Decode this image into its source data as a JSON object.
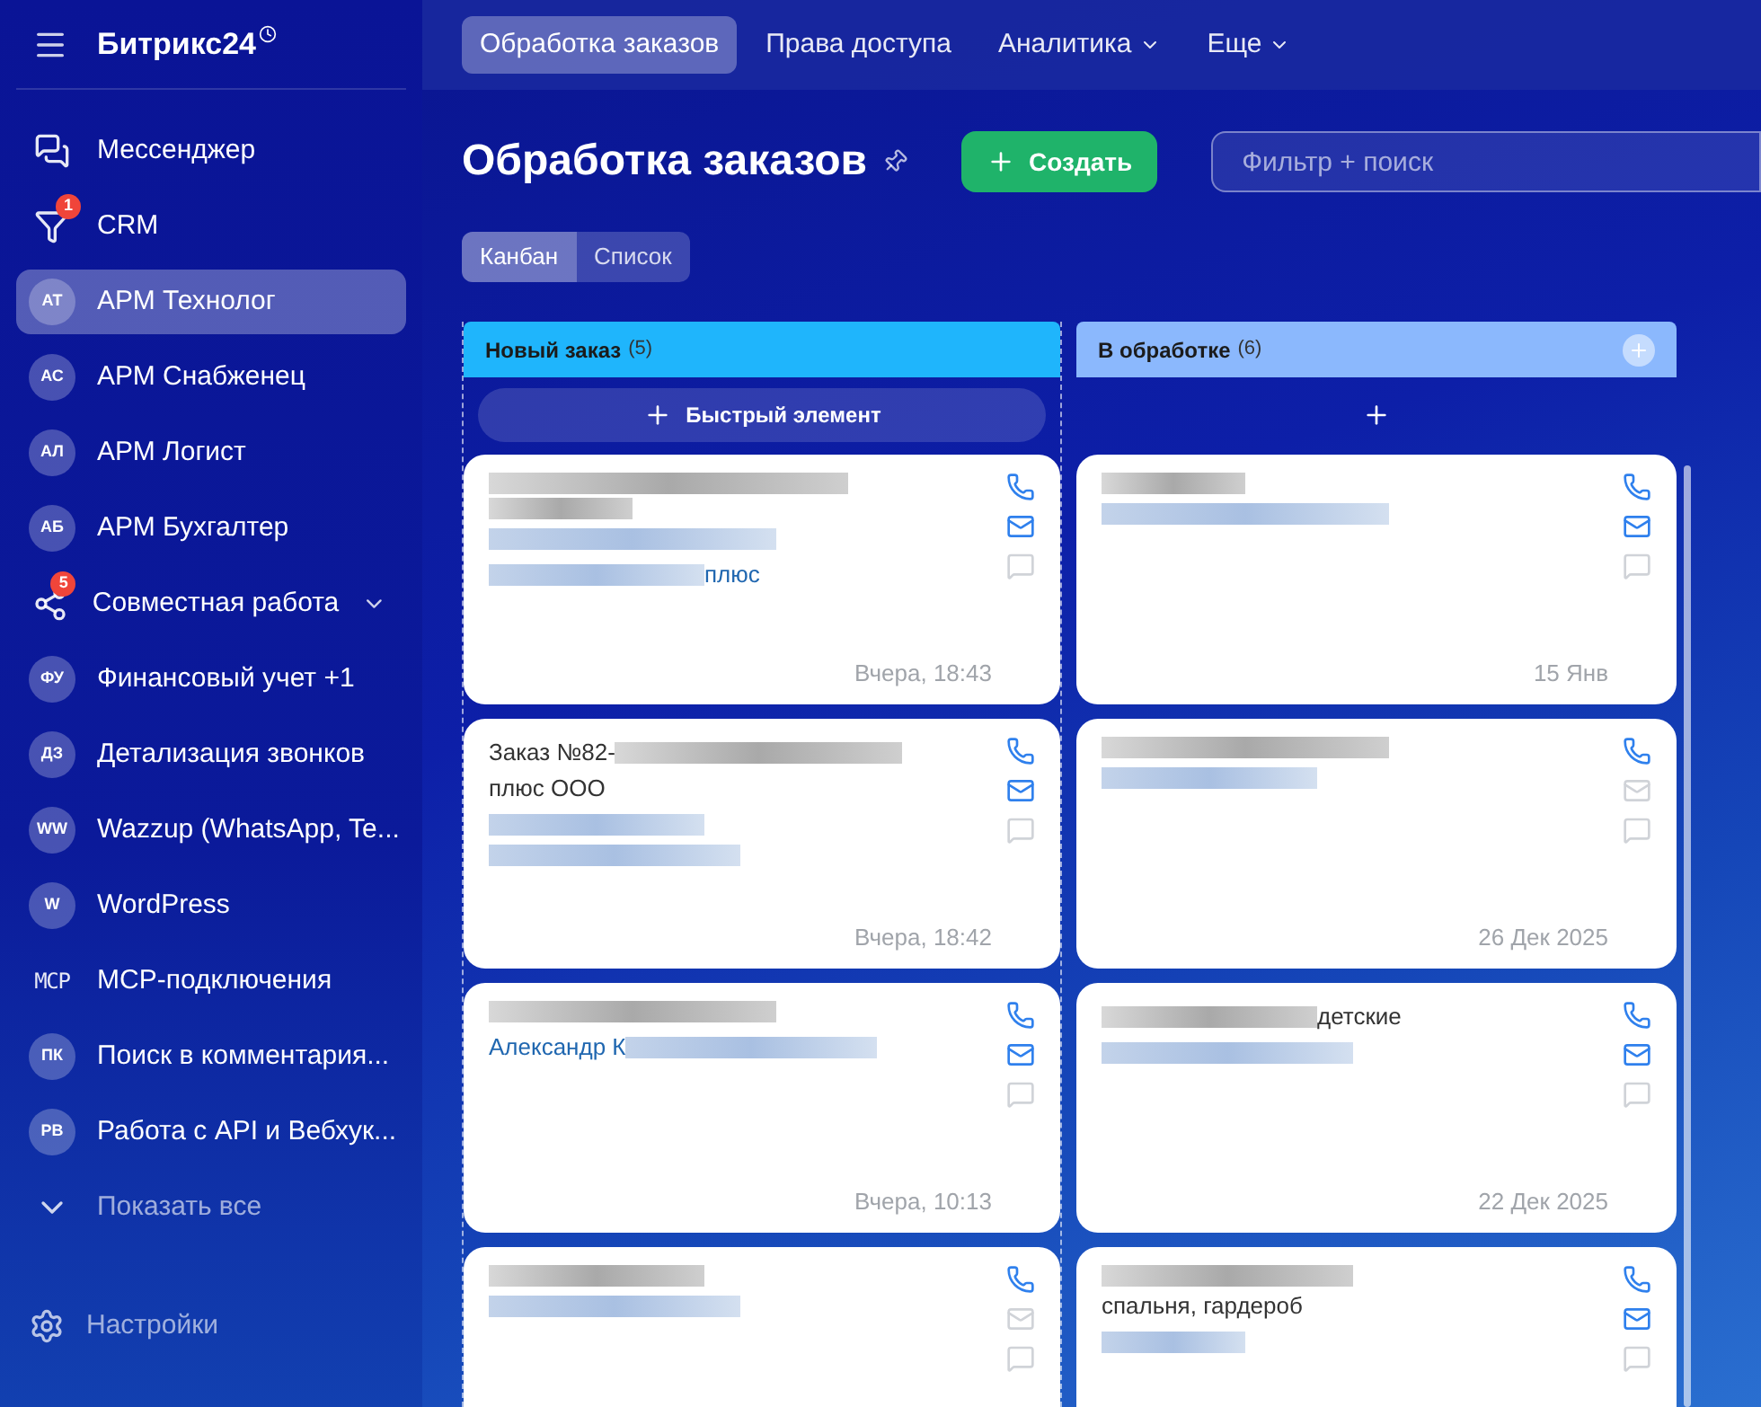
{
  "sidebar": {
    "logo": "Битрикс24",
    "items": [
      {
        "kind": "messenger",
        "label": "Мессенджер",
        "selected": false
      },
      {
        "kind": "crm",
        "label": "CRM",
        "badge": "1",
        "selected": false
      },
      {
        "kind": "avatar",
        "initials": "АТ",
        "label": "АРМ Технолог",
        "selected": true
      },
      {
        "kind": "avatar",
        "initials": "АС",
        "label": "АРМ Снабженец",
        "selected": false
      },
      {
        "kind": "avatar",
        "initials": "АЛ",
        "label": "АРМ Логист",
        "selected": false
      },
      {
        "kind": "avatar",
        "initials": "АБ",
        "label": "АРМ Бухгалтер",
        "selected": false
      },
      {
        "kind": "group",
        "label": "Совместная работа",
        "badge": "5",
        "expandable": true,
        "selected": false
      },
      {
        "kind": "avatar",
        "initials": "ФУ",
        "label": "Финансовый учет +1",
        "selected": false
      },
      {
        "kind": "avatar",
        "initials": "ДЗ",
        "label": "Детализация звонков",
        "selected": false
      },
      {
        "kind": "avatar",
        "initials": "WW",
        "label": "Wazzup (WhatsApp, Te...",
        "selected": false
      },
      {
        "kind": "avatar",
        "initials": "W",
        "label": "WordPress",
        "selected": false
      },
      {
        "kind": "mono",
        "initials": "MCP",
        "label": "MCP-подключения",
        "selected": false
      },
      {
        "kind": "avatar",
        "initials": "ПК",
        "label": "Поиск в комментария...",
        "selected": false
      },
      {
        "kind": "avatar",
        "initials": "РВ",
        "label": "Работа с API и Вебхук...",
        "selected": false
      },
      {
        "kind": "more",
        "label": "Показать все",
        "selected": false
      }
    ],
    "settings": "Настройки"
  },
  "top_tabs": [
    {
      "label": "Обработка заказов",
      "selected": true,
      "dropdown": false
    },
    {
      "label": "Права доступа",
      "selected": false,
      "dropdown": false
    },
    {
      "label": "Аналитика",
      "selected": false,
      "dropdown": true
    },
    {
      "label": "Еще",
      "selected": false,
      "dropdown": true
    }
  ],
  "page": {
    "title": "Обработка заказов",
    "create_button": "Создать",
    "search": {
      "placeholder": "Фильтр + поиск"
    }
  },
  "view_tabs": [
    {
      "label": "Канбан",
      "selected": true
    },
    {
      "label": "Список",
      "selected": false
    }
  ],
  "columns": [
    {
      "title": "Новый заказ",
      "count": "(5)",
      "color": "#1fb5fc",
      "quick_add": "Быстрый элемент",
      "cards": [
        {
          "email": true,
          "date": "Вчера, 18:43",
          "lines": [
            {
              "kind": "title",
              "parts": [
                {
                  "kind": "redacted"
                }
              ]
            },
            {
              "kind": "title",
              "parts": [
                {
                  "kind": "redacted"
                }
              ]
            },
            {
              "kind": "link",
              "parts": [
                {
                  "kind": "redacted"
                }
              ]
            },
            {
              "kind": "link",
              "parts": [
                {
                  "kind": "redacted"
                },
                {
                  "kind": "text",
                  "text": "плюс"
                }
              ]
            }
          ]
        },
        {
          "email": true,
          "date": "Вчера, 18:42",
          "lines": [
            {
              "kind": "title",
              "parts": [
                {
                  "kind": "text",
                  "text": "Заказ №82-"
                },
                {
                  "kind": "redacted"
                }
              ]
            },
            {
              "kind": "title",
              "parts": [
                {
                  "kind": "text",
                  "text": "плюс ООО"
                }
              ]
            },
            {
              "kind": "link",
              "parts": [
                {
                  "kind": "redacted"
                }
              ]
            },
            {
              "kind": "link",
              "parts": [
                {
                  "kind": "redacted"
                }
              ]
            }
          ]
        },
        {
          "email": true,
          "date": "Вчера, 10:13",
          "lines": [
            {
              "kind": "title",
              "parts": [
                {
                  "kind": "redacted"
                }
              ]
            },
            {
              "kind": "link",
              "parts": [
                {
                  "kind": "text",
                  "text": "Александр К"
                },
                {
                  "kind": "redacted"
                }
              ]
            }
          ]
        },
        {
          "email": false,
          "lines": [
            {
              "kind": "title",
              "parts": [
                {
                  "kind": "redacted"
                }
              ]
            },
            {
              "kind": "link",
              "parts": [
                {
                  "kind": "redacted"
                }
              ]
            }
          ]
        }
      ]
    },
    {
      "title": "В обработке",
      "count": "(6)",
      "color": "#8bb8fd",
      "cards": [
        {
          "email": true,
          "date": "15 Янв",
          "lines": [
            {
              "kind": "title",
              "parts": [
                {
                  "kind": "redacted"
                }
              ]
            },
            {
              "kind": "link",
              "parts": [
                {
                  "kind": "redacted"
                }
              ]
            }
          ]
        },
        {
          "email": false,
          "date": "26 Дек 2025",
          "lines": [
            {
              "kind": "title",
              "parts": [
                {
                  "kind": "redacted"
                }
              ]
            },
            {
              "kind": "link",
              "parts": [
                {
                  "kind": "redacted"
                }
              ]
            }
          ]
        },
        {
          "email": true,
          "date": "22 Дек 2025",
          "lines": [
            {
              "kind": "title",
              "parts": [
                {
                  "kind": "redacted"
                },
                {
                  "kind": "text",
                  "text": "детские"
                }
              ]
            },
            {
              "kind": "link",
              "parts": [
                {
                  "kind": "redacted"
                }
              ]
            }
          ]
        },
        {
          "email": true,
          "lines": [
            {
              "kind": "title",
              "parts": [
                {
                  "kind": "redacted"
                }
              ]
            },
            {
              "kind": "title",
              "parts": [
                {
                  "kind": "text",
                  "text": "спальня, гардероб"
                }
              ]
            },
            {
              "kind": "link",
              "parts": [
                {
                  "kind": "redacted"
                }
              ]
            }
          ]
        }
      ]
    }
  ]
}
